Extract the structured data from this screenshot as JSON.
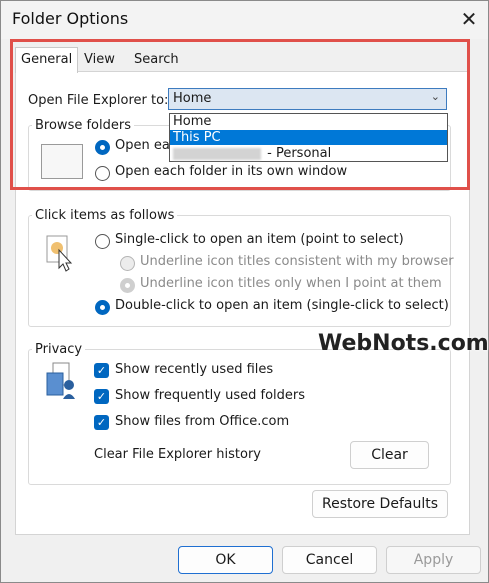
{
  "window": {
    "title": "Folder Options",
    "close_icon": "close-icon"
  },
  "tabs": [
    {
      "label": "General",
      "active": true
    },
    {
      "label": "View"
    },
    {
      "label": "Search"
    }
  ],
  "general": {
    "open_label": "Open File Explorer to:",
    "combo_value": "Home",
    "dropdown_options": [
      "Home",
      "This PC",
      " - Personal"
    ],
    "dropdown_selected": "This PC",
    "browse_title": "Browse folders",
    "browse_opt1": "Open each folder in the same window",
    "browse_opt1_visible": "Open ea",
    "browse_opt2": "Open each folder in its own window",
    "click_title": "Click items as follows",
    "click_single": "Single-click to open an item (point to select)",
    "click_underline1": "Underline icon titles consistent with my browser",
    "click_underline2": "Underline icon titles only when I point at them",
    "click_double": "Double-click to open an item (single-click to select)",
    "privacy_title": "Privacy",
    "privacy_recent": "Show recently used files",
    "privacy_frequent": "Show frequently used folders",
    "privacy_office": "Show files from Office.com",
    "clear_history_label": "Clear File Explorer history",
    "clear_button": "Clear",
    "restore_button": "Restore Defaults"
  },
  "footer": {
    "ok": "OK",
    "cancel": "Cancel",
    "apply": "Apply"
  },
  "watermark": "WebNots.com",
  "colors": {
    "accent": "#0067c0",
    "highlight": "#e0504a",
    "selection": "#0078d7"
  }
}
